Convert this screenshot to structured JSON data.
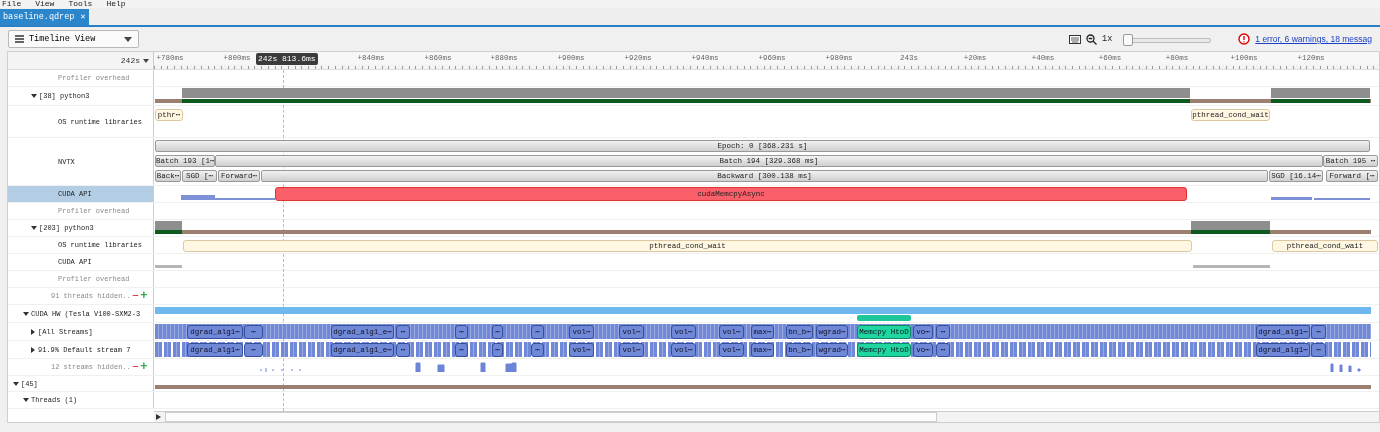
{
  "menu": [
    "File",
    "View",
    "Tools",
    "Help"
  ],
  "tabs": [
    {
      "label": "baseline.qdrep",
      "selected": true,
      "close": "✕"
    }
  ],
  "toolbar": {
    "view": "Timeline View",
    "zoom": "1x",
    "zoom_slider": {
      "level": 0.0
    },
    "messages": "1 error, 6 warnings, 18 messag"
  },
  "ruler": {
    "base": "242s",
    "cursor": "242s 813.6ms",
    "ticks": [
      "+780ms",
      "+800ms",
      "+840ms",
      "+860ms",
      "+880ms",
      "+900ms",
      "+920ms",
      "+940ms",
      "+960ms",
      "+980ms",
      "243s",
      "+20ms",
      "+40ms",
      "+60ms",
      "+80ms",
      "+100ms",
      "+120ms"
    ]
  },
  "rows": [
    {
      "label": "Profiler overhead",
      "kind": "overhead",
      "selected": false
    },
    {
      "label": "[38] python3",
      "kind": "process",
      "expanded": true,
      "selected": false,
      "children": [
        {
          "label": "OS runtime libraries",
          "kind": "os",
          "selected": false,
          "events": [
            {
              "label": "pthr⋯"
            },
            {
              "label": "pthread_cond_wait"
            }
          ]
        },
        {
          "label": "NVTX",
          "kind": "nvtx",
          "selected": false,
          "events": [
            {
              "label": "Epoch: 0 [368.231 s]"
            },
            {
              "label": "Batch 193 [1⋯"
            },
            {
              "label": "Batch 194 [329.368 ms]"
            },
            {
              "label": "Batch 195 ⋯"
            },
            {
              "label": "Back⋯"
            },
            {
              "label": "SGD [⋯"
            },
            {
              "label": "Forward⋯"
            },
            {
              "label": "Backward [300.138 ms]"
            },
            {
              "label": "SGD [16.14⋯"
            },
            {
              "label": "Forward [⋯"
            }
          ]
        },
        {
          "label": "CUDA API",
          "kind": "api",
          "selected": true,
          "events": [
            {
              "label": "cudaMemcpyAsync"
            }
          ]
        },
        {
          "label": "Profiler overhead",
          "kind": "overhead",
          "selected": false
        }
      ]
    },
    {
      "label": "[203] python3",
      "kind": "process",
      "expanded": true,
      "selected": false,
      "children": [
        {
          "label": "OS runtime libraries",
          "kind": "os",
          "selected": false,
          "events": [
            {
              "label": "pthread_cond_wait"
            },
            {
              "label": "pthread_cond_wait"
            }
          ]
        },
        {
          "label": "CUDA API",
          "kind": "api",
          "selected": false
        },
        {
          "label": "Profiler overhead",
          "kind": "overhead",
          "selected": false
        }
      ]
    },
    {
      "label": "91 threads hidden..",
      "kind": "hidden",
      "selected": false,
      "minus": "—",
      "plus": "+"
    },
    {
      "label": "CUDA HW (Tesla V100-SXM2-3",
      "kind": "device",
      "expanded": true,
      "selected": false,
      "children": [
        {
          "label": "[All Streams]",
          "kind": "stream",
          "expanded": false,
          "selected": false,
          "events": [
            {
              "label": "dgrad_alg1⋯"
            },
            {
              "label": "⋯"
            },
            {
              "label": "dgrad_alg1_e⋯"
            },
            {
              "label": "⋯"
            },
            {
              "label": "⋯"
            },
            {
              "label": "⋯"
            },
            {
              "label": "⋯"
            },
            {
              "label": "vol⋯"
            },
            {
              "label": "vol⋯"
            },
            {
              "label": "vol⋯"
            },
            {
              "label": "vol⋯"
            },
            {
              "label": "max⋯"
            },
            {
              "label": "bn_b⋯"
            },
            {
              "label": "wgrad⋯"
            },
            {
              "label": "Memcpy HtoD",
              "kind": "memcpy"
            },
            {
              "label": "vo⋯"
            },
            {
              "label": "⋯"
            },
            {
              "label": "dgrad_alg1⋯"
            },
            {
              "label": "⋯"
            }
          ]
        },
        {
          "label": "91.9% Default stream 7",
          "kind": "stream",
          "expanded": false,
          "selected": false,
          "events": [
            {
              "label": "dgrad_alg1⋯"
            },
            {
              "label": "⋯"
            },
            {
              "label": "dgrad_alg1_e⋯"
            },
            {
              "label": "⋯"
            },
            {
              "label": "⋯"
            },
            {
              "label": "⋯"
            },
            {
              "label": "⋯"
            },
            {
              "label": "vol⋯"
            },
            {
              "label": "vol⋯"
            },
            {
              "label": "vol⋯"
            },
            {
              "label": "vol⋯"
            },
            {
              "label": "max⋯"
            },
            {
              "label": "bn_b⋯"
            },
            {
              "label": "wgrad⋯"
            },
            {
              "label": "Memcpy HtoD",
              "kind": "memcpy"
            },
            {
              "label": "vo⋯"
            },
            {
              "label": "⋯"
            },
            {
              "label": "dgrad_alg1⋯"
            },
            {
              "label": "⋯"
            }
          ]
        },
        {
          "label": "12 streams hidden..",
          "kind": "hidden",
          "selected": false,
          "minus": "—",
          "plus": "+"
        }
      ]
    },
    {
      "label": "[45]",
      "kind": "process",
      "expanded": true,
      "selected": false,
      "children": [
        {
          "label": "Threads (1)",
          "kind": "group",
          "expanded": true,
          "selected": false
        }
      ]
    }
  ]
}
